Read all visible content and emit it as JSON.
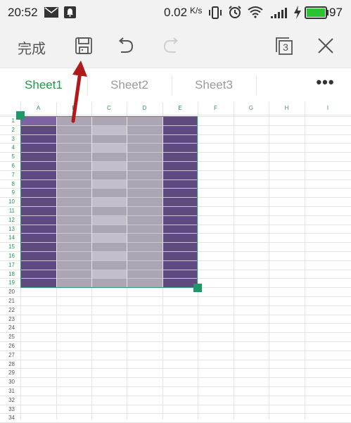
{
  "status_bar": {
    "time": "20:52",
    "network_speed": "0.02",
    "network_unit": "K/s",
    "battery": "97",
    "icons": [
      "message-icon",
      "notification-icon",
      "vibrate-icon",
      "alarm-icon",
      "wifi-icon",
      "signal-icon",
      "charging-icon",
      "battery-icon"
    ]
  },
  "toolbar": {
    "done_label": "完成",
    "sheet_count": "3",
    "icons": [
      "save-icon",
      "undo-icon",
      "redo-icon",
      "sheets-icon",
      "close-icon"
    ]
  },
  "tabs": [
    {
      "label": "Sheet1",
      "active": true
    },
    {
      "label": "Sheet2",
      "active": false
    },
    {
      "label": "Sheet3",
      "active": false
    }
  ],
  "more_label": "•••",
  "grid": {
    "columns": [
      "A",
      "B",
      "C",
      "D",
      "E",
      "F",
      "G",
      "H",
      "I"
    ],
    "selected_columns": [
      "A",
      "B",
      "C",
      "D",
      "E"
    ],
    "rows": [
      "1",
      "2",
      "3",
      "4",
      "5",
      "6",
      "7",
      "8",
      "9",
      "10",
      "11",
      "12",
      "13",
      "14",
      "15",
      "16",
      "17",
      "18",
      "19",
      "20",
      "21",
      "22",
      "23",
      "24",
      "25",
      "26",
      "27",
      "28",
      "29",
      "30",
      "31",
      "32",
      "33",
      "34"
    ],
    "selected_rows": 19
  },
  "colors": {
    "accent": "#1c9a4a",
    "dark_purple": "#5e4a7e",
    "active_cell": "#7e63a4",
    "mid_gray": "#aba5b4",
    "light_gray": "#c3bfca",
    "arrow": "#b01a1a"
  }
}
